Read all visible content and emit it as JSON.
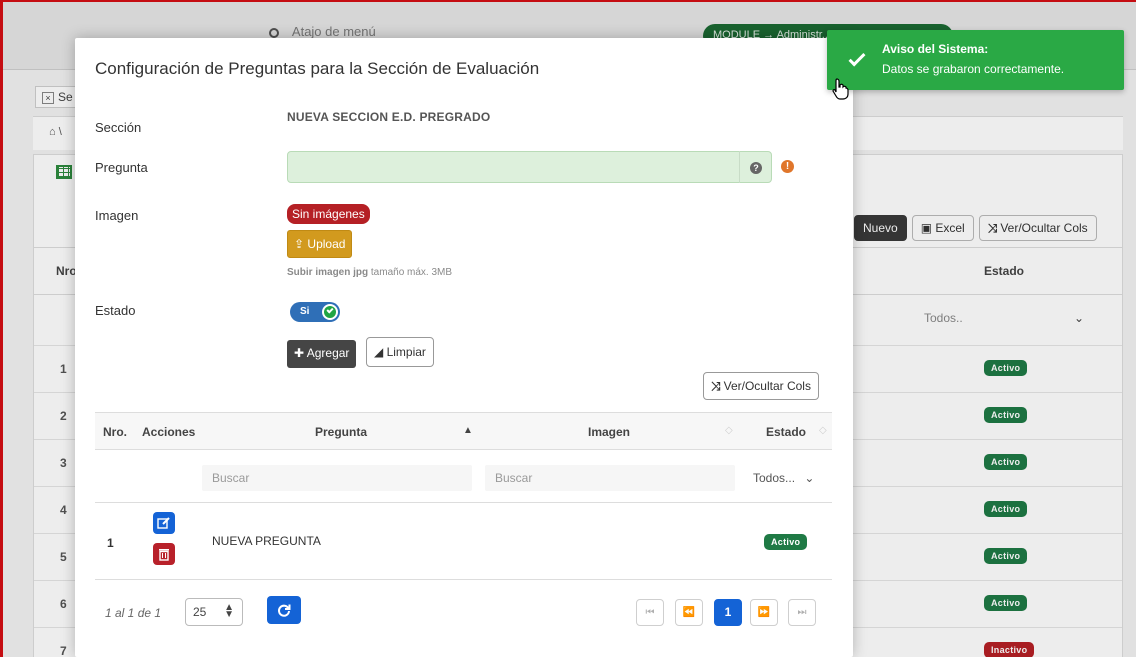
{
  "background": {
    "search_placeholder": "Atajo de menú",
    "module_label": "MODULE → Administr...",
    "tab_label": "Se",
    "breadcrumb": "\\",
    "buttons": {
      "new": "Nuevo",
      "excel": "Excel",
      "cols": "Ver/Ocultar Cols"
    },
    "table": {
      "nro_header": "Nro",
      "estado_header": "Estado",
      "estado_filter": "Todos..",
      "rows": [
        {
          "n": "1",
          "status": "Activo"
        },
        {
          "n": "2",
          "status": "Activo"
        },
        {
          "n": "3",
          "status": "Activo"
        },
        {
          "n": "4",
          "status": "Activo"
        },
        {
          "n": "5",
          "status": "Activo"
        },
        {
          "n": "6",
          "status": "Activo"
        },
        {
          "n": "7",
          "status": "Inactivo"
        }
      ]
    }
  },
  "modal": {
    "title": "Configuración de Preguntas para la Sección de Evaluación",
    "labels": {
      "section": "Sección",
      "question": "Pregunta",
      "image": "Imagen",
      "status": "Estado"
    },
    "section_value": "NUEVA SECCION E.D. PREGRADO",
    "question_value": "",
    "no_images": "Sin imágenes",
    "upload_label": "Upload",
    "upload_hint_bold": "Subir imagen jpg",
    "upload_hint": "tamaño máx. 3MB",
    "status_toggle": "Si",
    "add_label": "Agregar",
    "clear_label": "Limpiar",
    "cols_label": "Ver/Ocultar Cols",
    "table": {
      "headers": {
        "nro": "Nro.",
        "actions": "Acciones",
        "question": "Pregunta",
        "image": "Imagen",
        "status": "Estado"
      },
      "filters": {
        "question_placeholder": "Buscar",
        "image_placeholder": "Buscar",
        "status": "Todos..."
      },
      "rows": [
        {
          "n": "1",
          "question": "NUEVA PREGUNTA",
          "status": "Activo"
        }
      ]
    },
    "footer": {
      "info": "1 al 1 de 1",
      "page_size": "25",
      "pages": [
        "⏮",
        "⏪",
        "1",
        "⏩",
        "⏭"
      ],
      "current_page": "1"
    }
  },
  "toast": {
    "title": "Aviso del Sistema:",
    "message": "Datos se grabaron correctamente."
  },
  "colors": {
    "success": "#2aa945",
    "primary": "#1463d6",
    "danger": "#b52025",
    "warning": "#d29a1e",
    "dark": "#454545"
  }
}
